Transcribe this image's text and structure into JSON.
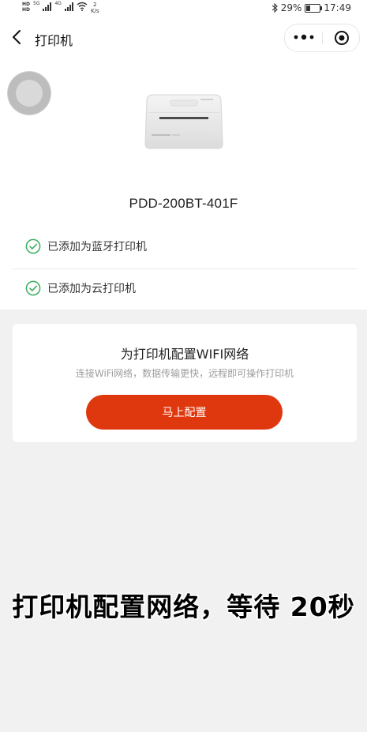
{
  "status_bar": {
    "network_1": "HD",
    "network_2": "HD",
    "sig_1": "5G",
    "sig_2": "4G",
    "speed_value": "2",
    "speed_unit": "K/s",
    "battery": "29%",
    "battery_level": 0.29,
    "time": "17:49"
  },
  "nav": {
    "title": "打印机"
  },
  "device": {
    "model": "PDD-200BT-401F"
  },
  "status_items": [
    {
      "label": "已添加为蓝牙打印机"
    },
    {
      "label": "已添加为云打印机"
    }
  ],
  "wifi_card": {
    "title": "为打印机配置WIFI网络",
    "subtitle": "连接WiFi网络，数据传输更快，远程即可操作打印机",
    "button_label": "马上配置"
  },
  "caption": "打印机配置网络，等待 20秒",
  "colors": {
    "accent": "#e0380e",
    "success": "#3cae5f",
    "page_bg": "#f1f1f1"
  }
}
